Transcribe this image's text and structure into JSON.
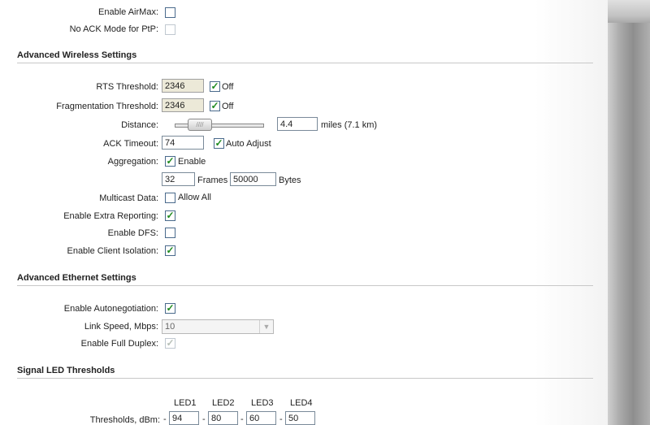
{
  "top": {
    "enable_airmax_label": "Enable AirMax:",
    "enable_airmax_checked": false,
    "no_ack_label": "No ACK Mode for PtP:",
    "no_ack_checked": false
  },
  "advanced_wireless": {
    "title": "Advanced Wireless Settings",
    "rts_label": "RTS Threshold:",
    "rts_value": "2346",
    "rts_off_label": "Off",
    "frag_label": "Fragmentation Threshold:",
    "frag_value": "2346",
    "frag_off_label": "Off",
    "distance_label": "Distance:",
    "distance_value": "4.4",
    "distance_unit": "miles (7.1 km)",
    "distance_slider_fraction": 0.2,
    "ack_label": "ACK Timeout:",
    "ack_value": "74",
    "auto_adjust_label": "Auto Adjust",
    "aggregation_label": "Aggregation:",
    "aggregation_enable_label": "Enable",
    "frames_value": "32",
    "frames_label": "Frames",
    "bytes_value": "50000",
    "bytes_label": "Bytes",
    "multicast_label": "Multicast Data:",
    "allow_all_label": "Allow All",
    "extra_reporting_label": "Enable Extra Reporting:",
    "dfs_label": "Enable DFS:",
    "client_isolation_label": "Enable Client Isolation:"
  },
  "advanced_ethernet": {
    "title": "Advanced Ethernet Settings",
    "autoneg_label": "Enable Autonegotiation:",
    "link_speed_label": "Link Speed, Mbps:",
    "link_speed_value": "10",
    "full_duplex_label": "Enable Full Duplex:"
  },
  "signal_led": {
    "title": "Signal LED Thresholds",
    "headers": [
      "LED1",
      "LED2",
      "LED3",
      "LED4"
    ],
    "thresholds_label": "Thresholds, dBm:",
    "values": [
      "94",
      "80",
      "60",
      "50"
    ],
    "separator": "-"
  },
  "icons": {
    "check": "✓",
    "dropdown": "▼",
    "slider_grip": "////"
  }
}
